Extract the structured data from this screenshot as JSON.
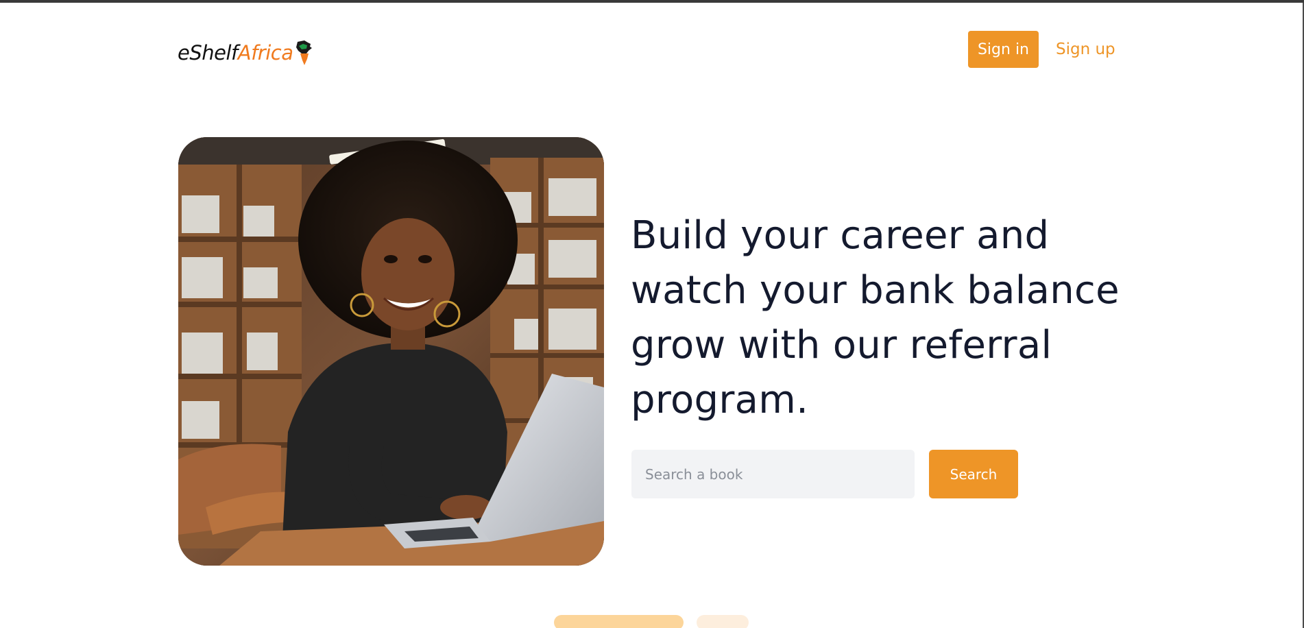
{
  "brand": {
    "name_primary": "eShelf",
    "name_accent": "Africa",
    "accent_color": "#f07b1f",
    "map_icon": "africa-map-icon"
  },
  "nav": {
    "signin_label": "Sign in",
    "signup_label": "Sign up"
  },
  "hero": {
    "headline": "Build your career and watch your bank balance grow with our referral program.",
    "image_icon": "woman-with-laptop-photo"
  },
  "search": {
    "placeholder": "Search a book",
    "value": "",
    "button_label": "Search"
  },
  "carousel": {
    "active_index": 0,
    "slides_count": 2
  },
  "colors": {
    "primary": "#ee9527",
    "headline": "#141a2e",
    "input_bg": "#f2f3f5"
  }
}
